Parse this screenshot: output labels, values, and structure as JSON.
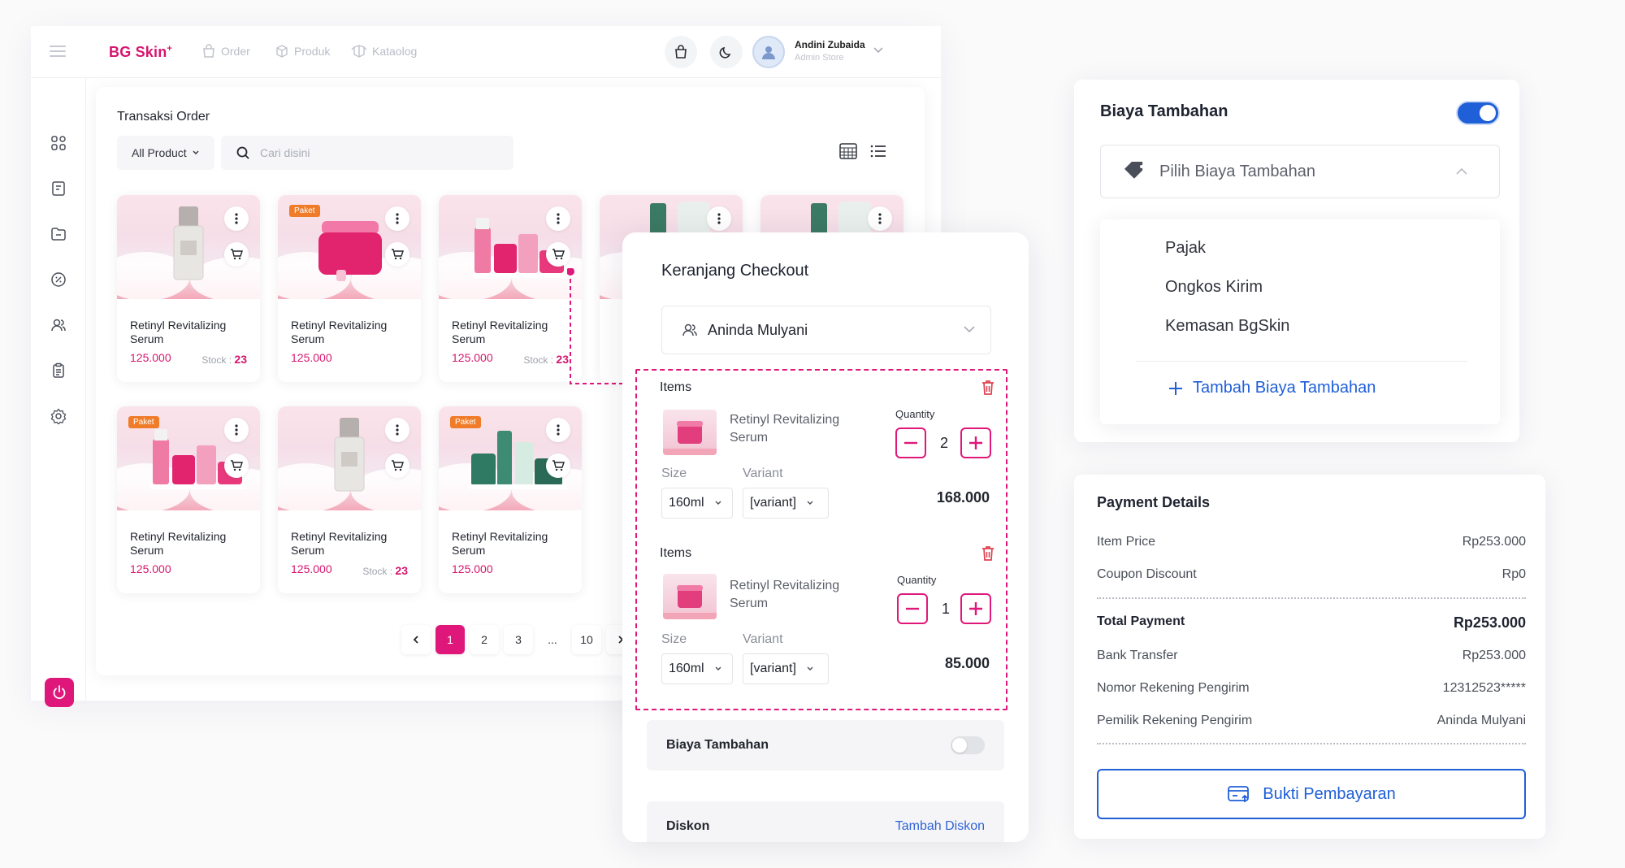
{
  "app": {
    "brand": "BG Skin",
    "brand_mark": "+",
    "nav": [
      {
        "label": "Order",
        "icon": "bag-icon"
      },
      {
        "label": "Produk",
        "icon": "box-icon"
      },
      {
        "label": "Kataolog",
        "icon": "catalog-icon"
      }
    ],
    "user": {
      "name": "Andini Zubaida",
      "role": "Admin Store"
    },
    "sidebar_icons": [
      "dashboard-icon",
      "receipt-icon",
      "folder-icon",
      "discount-icon",
      "users-icon",
      "clipboard-icon",
      "settings-icon"
    ],
    "accent": "#e0177a"
  },
  "panel": {
    "title": "Transaksi Order",
    "filter_label": "All Product",
    "search_placeholder": "Cari disini"
  },
  "products": [
    {
      "name": "Retinyl Revitalizing Serum",
      "price": "125.000",
      "stock_label": "Stock :",
      "stock": "23",
      "badge": ""
    },
    {
      "name": "Retinyl Revitalizing Serum",
      "price": "125.000",
      "stock_label": "",
      "stock": "",
      "badge": "Paket"
    },
    {
      "name": "Retinyl Revitalizing Serum",
      "price": "125.000",
      "stock_label": "Stock :",
      "stock": "23",
      "badge": ""
    },
    {
      "name": "",
      "price": "",
      "stock_label": "",
      "stock": "",
      "badge": ""
    },
    {
      "name": "",
      "price": "",
      "stock_label": "",
      "stock": "",
      "badge": ""
    },
    {
      "name": "Retinyl Revitalizing Serum",
      "price": "125.000",
      "stock_label": "",
      "stock": "",
      "badge": "Paket"
    },
    {
      "name": "Retinyl Revitalizing Serum",
      "price": "125.000",
      "stock_label": "Stock :",
      "stock": "23",
      "badge": ""
    },
    {
      "name": "Retinyl Revitalizing Serum",
      "price": "125.000",
      "stock_label": "",
      "stock": "",
      "badge": "Paket"
    }
  ],
  "pagination": {
    "pages": [
      "1",
      "2",
      "3",
      "...",
      "10"
    ],
    "active": "1"
  },
  "checkout": {
    "title": "Keranjang Checkout",
    "customer": "Aninda Mulyani",
    "lines": [
      {
        "section": "Items",
        "name": "Retinyl Revitalizing Serum",
        "quantity_label": "Quantity",
        "quantity": "2",
        "size_label": "Size",
        "size": "160ml",
        "variant_label": "Variant",
        "variant": "[variant]",
        "price": "168.000"
      },
      {
        "section": "Items",
        "name": "Retinyl Revitalizing Serum",
        "quantity_label": "Quantity",
        "quantity": "1",
        "size_label": "Size",
        "size": "160ml",
        "variant_label": "Variant",
        "variant": "[variant]",
        "price": "85.000"
      }
    ],
    "biaya_label": "Biaya Tambahan",
    "biaya_enabled": false,
    "diskon_label": "Diskon",
    "diskon_action": "Tambah Diskon"
  },
  "biaya": {
    "title": "Biaya Tambahan",
    "enabled": true,
    "placeholder": "Pilih Biaya Tambahan",
    "options": [
      "Pajak",
      "Ongkos Kirim",
      "Kemasan BgSkin"
    ],
    "add_label": "Tambah Biaya Tambahan",
    "color": "#1f5fd8"
  },
  "payment": {
    "title": "Payment Details",
    "item_price_label": "Item Price",
    "item_price": "Rp253.000",
    "coupon_label": "Coupon Discount",
    "coupon": "Rp0",
    "total_label": "Total Payment",
    "total": "Rp253.000",
    "method_label": "Bank Transfer",
    "method_amount": "Rp253.000",
    "account_label": "Nomor Rekening Pengirim",
    "account": "12312523*****",
    "owner_label": "Pemilik Rekening Pengirim",
    "owner": "Aninda Mulyani",
    "button_label": "Bukti Pembayaran"
  }
}
